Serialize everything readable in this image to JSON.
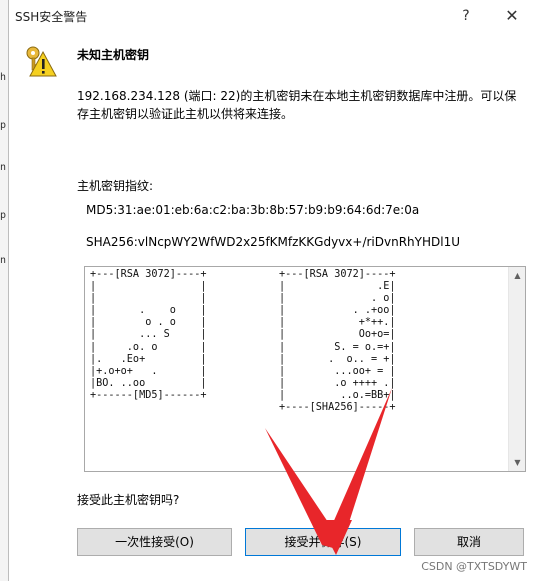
{
  "window": {
    "title": "SSH安全警告",
    "help_glyph": "?",
    "close_glyph": "✕"
  },
  "heading": "未知主机密钥",
  "message": "192.168.234.128 (端口: 22)的主机密钥未在本地主机密钥数据库中注册。可以保存主机密钥以验证此主机以供将来连接。",
  "fingerprint": {
    "label": "主机密钥指纹:",
    "md5": "MD5:31:ae:01:eb:6a:c2:ba:3b:8b:57:b9:b9:64:6d:7e:0a",
    "sha256": "SHA256:vlNcpWY2WfWD2x25fKMfzKKGdyvx+/riDvnRhYHDl1U"
  },
  "randomart": {
    "rsa_md5": "+---[RSA 3072]----+\n|                 |\n|                 |\n|       .    o    |\n|        o . o    |\n|       ... S     |\n|     .o. o       |\n|.   .Eo+         |\n|+.o+o+   .       |\n|BO. ..oo         |\n+------[MD5]------+",
    "rsa_sha256": "+---[RSA 3072]----+\n|               .E|\n|              . o|\n|           . .+oo|\n|            +*++.|\n|            Oo+o=|\n|        S. = o.=+|\n|       .  o.. = +|\n|        ...oo+ = |\n|        .o ++++ .|\n|         ..o.=BB+|\n+----[SHA256]-----+"
  },
  "question": "接受此主机密钥吗?",
  "buttons": {
    "accept_once": "一次性接受(O)",
    "accept_save": "接受并保存(S)",
    "cancel": "取消"
  },
  "watermark": "CSDN @TXTSDYWT",
  "icons": {
    "warning": "keys-warning-icon",
    "scroll_up": "▲",
    "scroll_down": "▼"
  },
  "colors": {
    "annotation_arrow": "#e8262a",
    "focus_border": "#0078d7"
  }
}
